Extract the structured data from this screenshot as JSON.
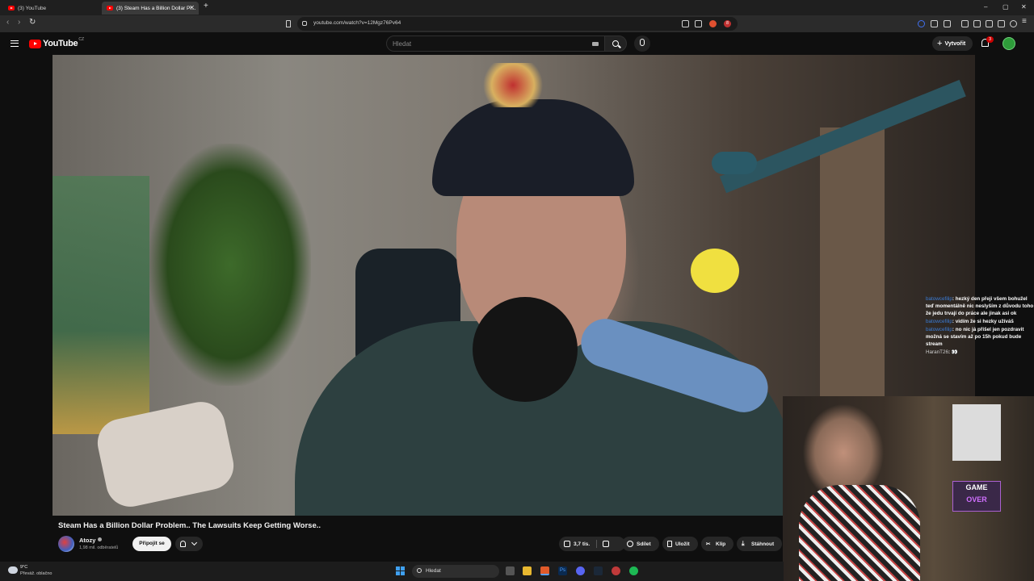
{
  "browser": {
    "tabs": [
      {
        "label": "(3) YouTube",
        "active": false
      },
      {
        "label": "(3) Steam Has a Billion Dollar Pr...",
        "active": true
      }
    ],
    "new_tab_label": "+",
    "url": "youtube.com/watch?v=12Mgz76Pv64",
    "window_controls": {
      "minimize": "–",
      "maximize": "▢",
      "close": "✕"
    },
    "extension_badge": "8"
  },
  "header": {
    "logo_text": "YouTube",
    "logo_country": "CZ",
    "search_placeholder": "Hledat",
    "create_label": "Vytvořit",
    "notifications_count": "3"
  },
  "chat": {
    "messages": [
      {
        "user": "batowcefilip",
        "text": ": hezký den přeji všem bohužel teď momentálně nic neslyším z důvodu toho že jedu trvají do práce ale jinak asi ok"
      },
      {
        "user": "batowcefilip",
        "text": ": vidím že si hezky užíváš"
      },
      {
        "user": "batowcefilip",
        "text": ": no nic já přišel jen pozdravit možná se stavím až po 15h pokud bude stream"
      },
      {
        "user": "HaranT26",
        "text": ": 👀",
        "alt": true
      }
    ]
  },
  "cam": {
    "sign_line1": "GAME",
    "sign_line2": "OVER"
  },
  "video": {
    "title": "Steam Has a Billion Dollar Problem.. The Lawsuits Keep Getting Worse..",
    "channel": "Atozy",
    "subscribers": "1,98 mil. odběratelů",
    "join_label": "Připojit se",
    "likes": "3,7 tis.",
    "share_label": "Sdílet",
    "save_label": "Uložit",
    "clip_label": "Klip",
    "download_label": "Stáhnout"
  },
  "taskbar": {
    "weather_temp": "9°C",
    "weather_desc": "Převáž. oblačno",
    "search_label": "Hledat"
  },
  "colors": {
    "accent": "#ff0000",
    "background": "#0f0f0f",
    "chat_user": "#3a7bd5"
  }
}
